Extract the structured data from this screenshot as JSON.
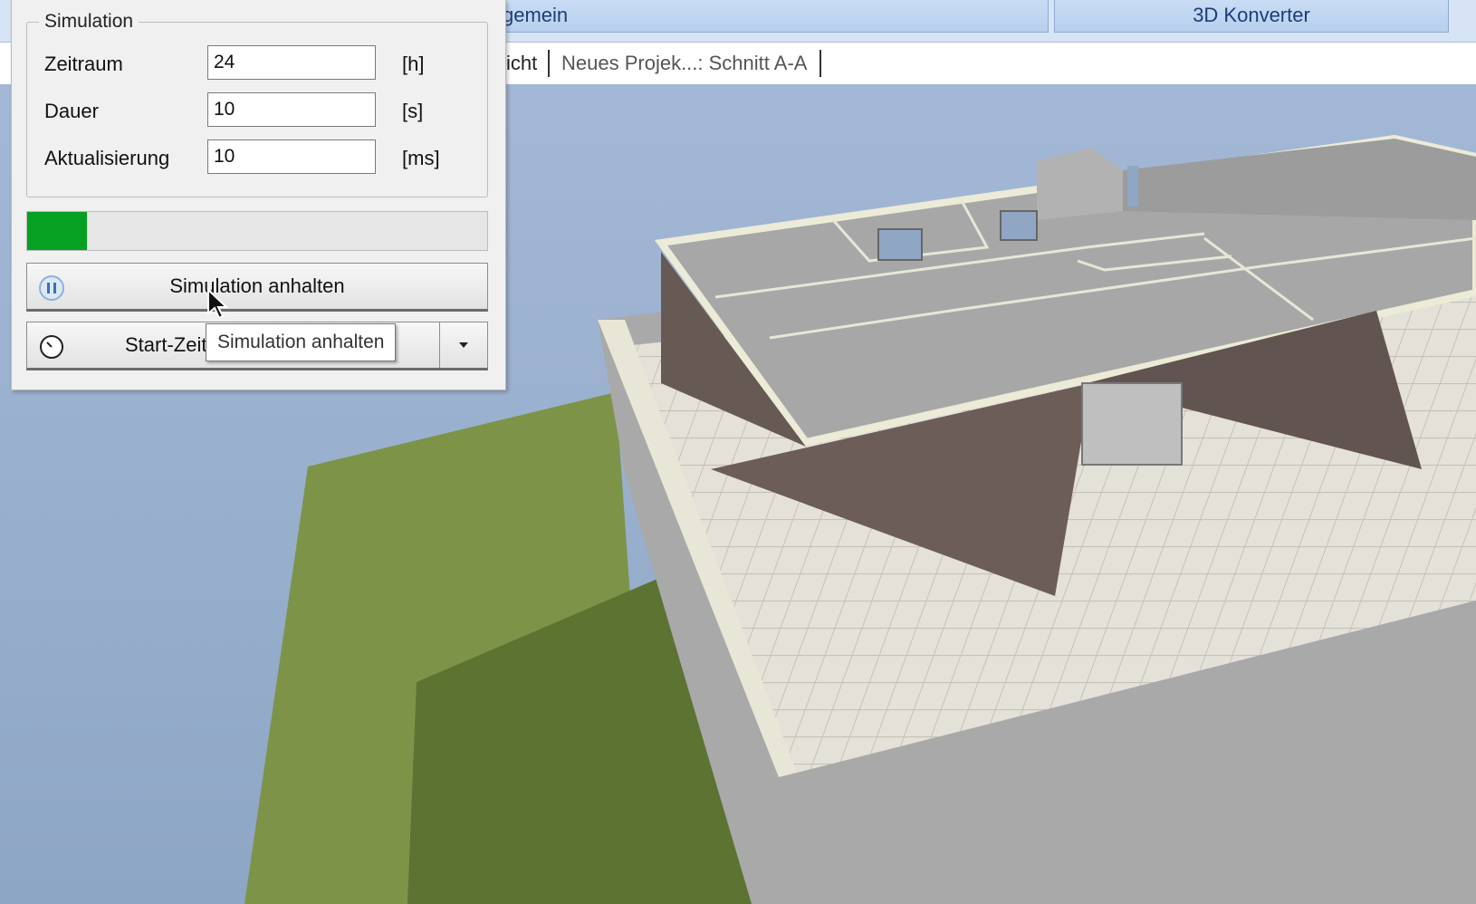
{
  "ribbon": {
    "tabs": [
      {
        "label": "gemein"
      },
      {
        "label": "3D Konverter"
      }
    ]
  },
  "doc_tabs": [
    {
      "label": "sicht"
    },
    {
      "label": "Neues Projek...: Schnitt A-A"
    }
  ],
  "panel": {
    "group_title": "Simulation",
    "fields": [
      {
        "label": "Zeitraum",
        "value": "24",
        "unit": "[h]"
      },
      {
        "label": "Dauer",
        "value": "10",
        "unit": "[s]"
      },
      {
        "label": "Aktualisierung",
        "value": "10",
        "unit": "[ms]"
      }
    ],
    "progress_fraction": 0.13,
    "progress_color": "#06a022",
    "pause_button_label": "Simulation anhalten",
    "pause_button_icon": "pause-icon",
    "start_time_button_label": "Start-Zeitp",
    "start_time_button_icon": "clock-icon",
    "tooltip": "Simulation anhalten"
  },
  "colors": {
    "sky": "#9fb5d3",
    "grass": "#7d9448",
    "roof": "#a7a7a7",
    "shade": "#675954"
  }
}
